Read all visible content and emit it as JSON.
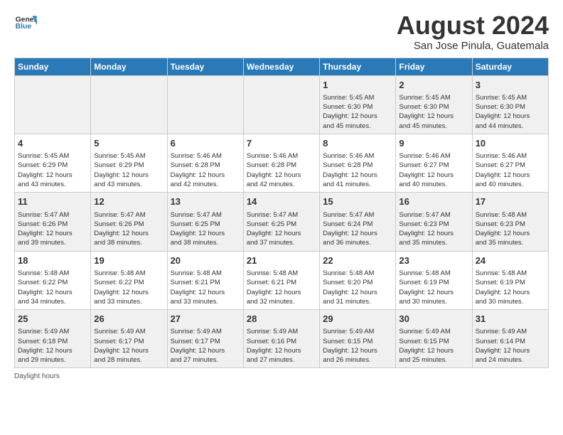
{
  "header": {
    "logo_line1": "General",
    "logo_line2": "Blue",
    "title": "August 2024",
    "subtitle": "San Jose Pinula, Guatemala"
  },
  "days_of_week": [
    "Sunday",
    "Monday",
    "Tuesday",
    "Wednesday",
    "Thursday",
    "Friday",
    "Saturday"
  ],
  "weeks": [
    [
      {
        "day": "",
        "info": ""
      },
      {
        "day": "",
        "info": ""
      },
      {
        "day": "",
        "info": ""
      },
      {
        "day": "",
        "info": ""
      },
      {
        "day": "1",
        "info": "Sunrise: 5:45 AM\nSunset: 6:30 PM\nDaylight: 12 hours\nand 45 minutes."
      },
      {
        "day": "2",
        "info": "Sunrise: 5:45 AM\nSunset: 6:30 PM\nDaylight: 12 hours\nand 45 minutes."
      },
      {
        "day": "3",
        "info": "Sunrise: 5:45 AM\nSunset: 6:30 PM\nDaylight: 12 hours\nand 44 minutes."
      }
    ],
    [
      {
        "day": "4",
        "info": "Sunrise: 5:45 AM\nSunset: 6:29 PM\nDaylight: 12 hours\nand 43 minutes."
      },
      {
        "day": "5",
        "info": "Sunrise: 5:45 AM\nSunset: 6:29 PM\nDaylight: 12 hours\nand 43 minutes."
      },
      {
        "day": "6",
        "info": "Sunrise: 5:46 AM\nSunset: 6:28 PM\nDaylight: 12 hours\nand 42 minutes."
      },
      {
        "day": "7",
        "info": "Sunrise: 5:46 AM\nSunset: 6:28 PM\nDaylight: 12 hours\nand 42 minutes."
      },
      {
        "day": "8",
        "info": "Sunrise: 5:46 AM\nSunset: 6:28 PM\nDaylight: 12 hours\nand 41 minutes."
      },
      {
        "day": "9",
        "info": "Sunrise: 5:46 AM\nSunset: 6:27 PM\nDaylight: 12 hours\nand 40 minutes."
      },
      {
        "day": "10",
        "info": "Sunrise: 5:46 AM\nSunset: 6:27 PM\nDaylight: 12 hours\nand 40 minutes."
      }
    ],
    [
      {
        "day": "11",
        "info": "Sunrise: 5:47 AM\nSunset: 6:26 PM\nDaylight: 12 hours\nand 39 minutes."
      },
      {
        "day": "12",
        "info": "Sunrise: 5:47 AM\nSunset: 6:26 PM\nDaylight: 12 hours\nand 38 minutes."
      },
      {
        "day": "13",
        "info": "Sunrise: 5:47 AM\nSunset: 6:25 PM\nDaylight: 12 hours\nand 38 minutes."
      },
      {
        "day": "14",
        "info": "Sunrise: 5:47 AM\nSunset: 6:25 PM\nDaylight: 12 hours\nand 37 minutes."
      },
      {
        "day": "15",
        "info": "Sunrise: 5:47 AM\nSunset: 6:24 PM\nDaylight: 12 hours\nand 36 minutes."
      },
      {
        "day": "16",
        "info": "Sunrise: 5:47 AM\nSunset: 6:23 PM\nDaylight: 12 hours\nand 35 minutes."
      },
      {
        "day": "17",
        "info": "Sunrise: 5:48 AM\nSunset: 6:23 PM\nDaylight: 12 hours\nand 35 minutes."
      }
    ],
    [
      {
        "day": "18",
        "info": "Sunrise: 5:48 AM\nSunset: 6:22 PM\nDaylight: 12 hours\nand 34 minutes."
      },
      {
        "day": "19",
        "info": "Sunrise: 5:48 AM\nSunset: 6:22 PM\nDaylight: 12 hours\nand 33 minutes."
      },
      {
        "day": "20",
        "info": "Sunrise: 5:48 AM\nSunset: 6:21 PM\nDaylight: 12 hours\nand 33 minutes."
      },
      {
        "day": "21",
        "info": "Sunrise: 5:48 AM\nSunset: 6:21 PM\nDaylight: 12 hours\nand 32 minutes."
      },
      {
        "day": "22",
        "info": "Sunrise: 5:48 AM\nSunset: 6:20 PM\nDaylight: 12 hours\nand 31 minutes."
      },
      {
        "day": "23",
        "info": "Sunrise: 5:48 AM\nSunset: 6:19 PM\nDaylight: 12 hours\nand 30 minutes."
      },
      {
        "day": "24",
        "info": "Sunrise: 5:48 AM\nSunset: 6:19 PM\nDaylight: 12 hours\nand 30 minutes."
      }
    ],
    [
      {
        "day": "25",
        "info": "Sunrise: 5:49 AM\nSunset: 6:18 PM\nDaylight: 12 hours\nand 29 minutes."
      },
      {
        "day": "26",
        "info": "Sunrise: 5:49 AM\nSunset: 6:17 PM\nDaylight: 12 hours\nand 28 minutes."
      },
      {
        "day": "27",
        "info": "Sunrise: 5:49 AM\nSunset: 6:17 PM\nDaylight: 12 hours\nand 27 minutes."
      },
      {
        "day": "28",
        "info": "Sunrise: 5:49 AM\nSunset: 6:16 PM\nDaylight: 12 hours\nand 27 minutes."
      },
      {
        "day": "29",
        "info": "Sunrise: 5:49 AM\nSunset: 6:15 PM\nDaylight: 12 hours\nand 26 minutes."
      },
      {
        "day": "30",
        "info": "Sunrise: 5:49 AM\nSunset: 6:15 PM\nDaylight: 12 hours\nand 25 minutes."
      },
      {
        "day": "31",
        "info": "Sunrise: 5:49 AM\nSunset: 6:14 PM\nDaylight: 12 hours\nand 24 minutes."
      }
    ]
  ],
  "footer": {
    "label": "Daylight hours"
  }
}
